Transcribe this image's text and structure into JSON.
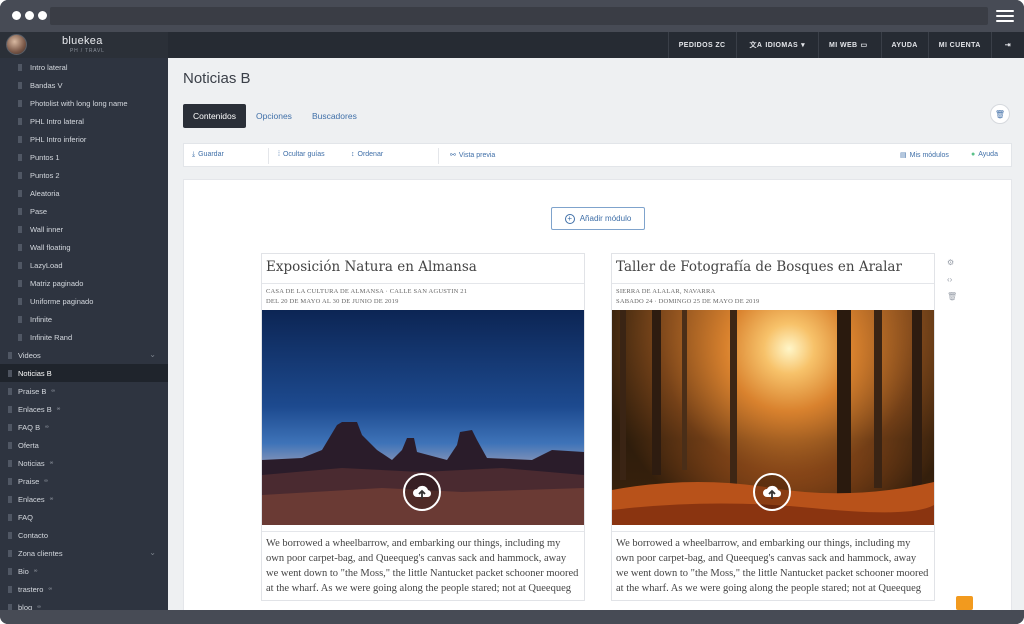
{
  "app": {
    "brand_name": "bluekea",
    "brand_sub": "PH / TRAVL"
  },
  "topnav": [
    {
      "label": "PEDIDOS ZC",
      "icon": ""
    },
    {
      "label": "IDIOMAS",
      "icon": "translate-icon"
    },
    {
      "label": "MI WEB",
      "icon": "monitor-icon"
    },
    {
      "label": "AYUDA",
      "icon": ""
    },
    {
      "label": "MI CUENTA",
      "icon": ""
    },
    {
      "label": "",
      "icon": "logout-icon"
    }
  ],
  "sidebar": {
    "items": [
      {
        "label": "Intro lateral",
        "level": "sub"
      },
      {
        "label": "Bandas V",
        "level": "sub"
      },
      {
        "label": "Photolist with long long name",
        "level": "sub"
      },
      {
        "label": "PHL Intro lateral",
        "level": "sub"
      },
      {
        "label": "PHL Intro inferior",
        "level": "sub"
      },
      {
        "label": "Puntos 1",
        "level": "sub"
      },
      {
        "label": "Puntos 2",
        "level": "sub"
      },
      {
        "label": "Aleatoria",
        "level": "sub"
      },
      {
        "label": "Pase",
        "level": "sub"
      },
      {
        "label": "Wall inner",
        "level": "sub"
      },
      {
        "label": "Wall floating",
        "level": "sub"
      },
      {
        "label": "LazyLoad",
        "level": "sub"
      },
      {
        "label": "Matriz paginado",
        "level": "sub"
      },
      {
        "label": "Uniforme paginado",
        "level": "sub"
      },
      {
        "label": "Infinite",
        "level": "sub"
      },
      {
        "label": "Infinite Rand",
        "level": "sub"
      },
      {
        "label": "Videos",
        "level": "top",
        "chevron": true
      },
      {
        "label": "Noticias B",
        "level": "top",
        "active": true
      },
      {
        "label": "Praise B",
        "level": "top",
        "hidden": true
      },
      {
        "label": "Enlaces B",
        "level": "top",
        "hidden": true
      },
      {
        "label": "FAQ B",
        "level": "top",
        "hidden": true
      },
      {
        "label": "Oferta",
        "level": "top"
      },
      {
        "label": "Noticias",
        "level": "top",
        "hidden": true
      },
      {
        "label": "Praise",
        "level": "top",
        "hidden": true
      },
      {
        "label": "Enlaces",
        "level": "top",
        "hidden": true
      },
      {
        "label": "FAQ",
        "level": "top"
      },
      {
        "label": "Contacto",
        "level": "top"
      },
      {
        "label": "Zona clientes",
        "level": "top",
        "chevron": true
      },
      {
        "label": "Bio",
        "level": "top",
        "hidden": true
      },
      {
        "label": "trastero",
        "level": "top",
        "hidden": true
      },
      {
        "label": "blog",
        "level": "top",
        "hidden": true
      }
    ]
  },
  "main": {
    "title": "Noticias B",
    "tabs": [
      {
        "label": "Contenidos",
        "active": true
      },
      {
        "label": "Opciones"
      },
      {
        "label": "Buscadores"
      }
    ],
    "toolbar": {
      "save": "Guardar",
      "hide_guides": "Ocultar guías",
      "sort": "Ordenar",
      "preview": "Vista previa",
      "my_modules": "Mis módulos",
      "help": "Ayuda"
    },
    "add_module": "Añadir módulo",
    "cards": [
      {
        "title": "Exposición Natura en Almansa",
        "meta1": "CASA DE LA CULTURA DE ALMANSA · CALLE SAN AGUSTIN 21",
        "meta2": "DEL 20 DE MAYO AL 30 DE JUNIO DE 2019",
        "image": "desert-night-photo",
        "body": "We borrowed a wheelbarrow, and embarking our things, including my own poor carpet-bag, and Queequeg's canvas sack and hammock, away we went down to \"the Moss,\" the little Nantucket packet schooner moored at the wharf. As we were going along the people stared; not at Queequeg"
      },
      {
        "title": "Taller de Fotografía de Bosques en Aralar",
        "meta1": "SIERRA DE ALALAR, NAVARRA",
        "meta2": "SABADO 24 · DOMINGO 25 DE MAYO DE 2019",
        "image": "autumn-forest-photo",
        "body": "We borrowed a wheelbarrow, and embarking our things, including my own poor carpet-bag, and Queequeg's canvas sack and hammock, away we went down to \"the Moss,\" the little Nantucket packet schooner moored at the wharf. As we were going along the people stared; not at Queequeg"
      }
    ]
  },
  "colors": {
    "accent": "#3f6fa8",
    "sidebar_bg": "#2e3440",
    "appbar_bg": "#262b33",
    "orange": "#f29a1e"
  }
}
